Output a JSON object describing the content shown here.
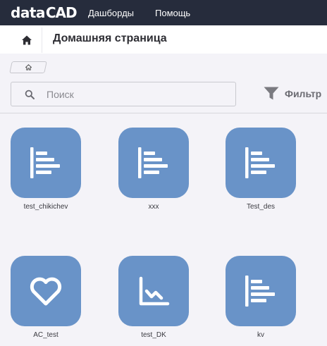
{
  "brand": {
    "prefix": "data",
    "suffix": "CAD"
  },
  "nav": {
    "dashboards": "Дашборды",
    "help": "Помощь"
  },
  "header": {
    "title": "Домашняя страница"
  },
  "search": {
    "placeholder": "Поиск"
  },
  "filter": {
    "label": "Фильтр"
  },
  "colors": {
    "topbar": "#262c3c",
    "tile": "#6993c8",
    "background": "#f4f3f8"
  },
  "dashboards": [
    {
      "name": "test_chikichev",
      "icon": "bar-chart-icon"
    },
    {
      "name": "xxx",
      "icon": "bar-chart-icon"
    },
    {
      "name": "Test_des",
      "icon": "bar-chart-icon"
    },
    {
      "name": "AC_test",
      "icon": "heart-icon"
    },
    {
      "name": "test_DK",
      "icon": "line-chart-icon"
    },
    {
      "name": "kv",
      "icon": "bar-chart-icon"
    }
  ]
}
